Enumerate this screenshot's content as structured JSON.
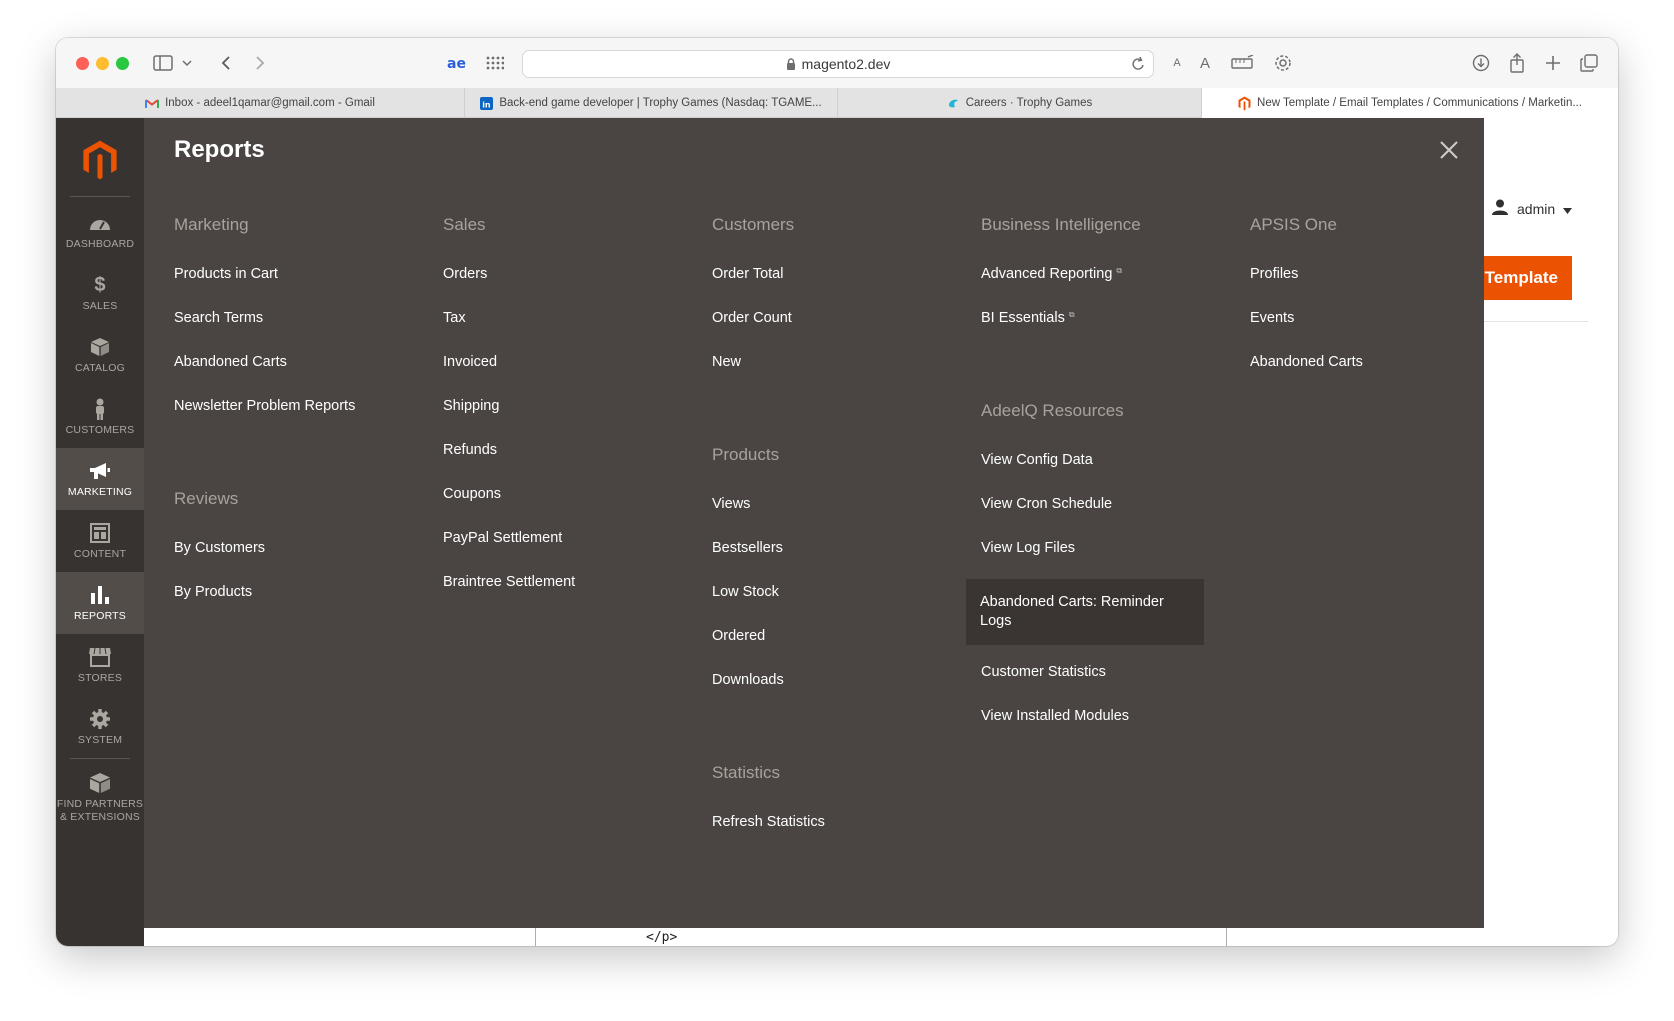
{
  "browser": {
    "address": "magento2.dev",
    "tabs": [
      {
        "label": "Inbox - adeel1qamar@gmail.com - Gmail",
        "icon": "gmail-icon"
      },
      {
        "label": "Back-end game developer | Trophy Games (Nasdaq: TGAME...",
        "icon": "linkedin-icon"
      },
      {
        "label": "Careers · Trophy Games",
        "icon": "trophy-games-icon"
      },
      {
        "label": "New Template / Email Templates / Communications / Marketin...",
        "icon": "magento-icon",
        "active": true
      }
    ]
  },
  "sidebar": {
    "items": [
      {
        "label": "DASHBOARD",
        "icon": "dashboard-icon"
      },
      {
        "label": "SALES",
        "icon": "dollar-icon"
      },
      {
        "label": "CATALOG",
        "icon": "catalog-box-icon"
      },
      {
        "label": "CUSTOMERS",
        "icon": "customers-icon"
      },
      {
        "label": "MARKETING",
        "icon": "megaphone-icon"
      },
      {
        "label": "CONTENT",
        "icon": "content-layout-icon"
      },
      {
        "label": "REPORTS",
        "icon": "bar-chart-icon",
        "active": true
      },
      {
        "label": "STORES",
        "icon": "store-icon"
      },
      {
        "label": "SYSTEM",
        "icon": "gear-icon"
      },
      {
        "label": "FIND PARTNERS",
        "label2": "& EXTENSIONS",
        "icon": "extensions-box-icon"
      }
    ]
  },
  "header": {
    "user": "admin",
    "button_partial": "Template"
  },
  "background": {
    "code_snippet": "</p>"
  },
  "menu": {
    "title": "Reports",
    "columns": [
      {
        "sections": [
          {
            "heading": "Marketing",
            "items": [
              "Products in Cart",
              "Search Terms",
              "Abandoned Carts",
              "Newsletter Problem Reports"
            ]
          },
          {
            "heading": "Reviews",
            "items": [
              "By Customers",
              "By Products"
            ]
          }
        ]
      },
      {
        "sections": [
          {
            "heading": "Sales",
            "items": [
              "Orders",
              "Tax",
              "Invoiced",
              "Shipping",
              "Refunds",
              "Coupons",
              "PayPal Settlement",
              "Braintree Settlement"
            ]
          }
        ]
      },
      {
        "sections": [
          {
            "heading": "Customers",
            "items": [
              "Order Total",
              "Order Count",
              "New"
            ]
          },
          {
            "heading": "Products",
            "items": [
              "Views",
              "Bestsellers",
              "Low Stock",
              "Ordered",
              "Downloads"
            ]
          },
          {
            "heading": "Statistics",
            "items": [
              "Refresh Statistics"
            ]
          }
        ]
      },
      {
        "sections": [
          {
            "heading": "Business Intelligence",
            "items": [
              "Advanced Reporting",
              "BI Essentials"
            ]
          },
          {
            "heading": "AdeelQ Resources",
            "items": [
              "View Config Data",
              "View Cron Schedule",
              "View Log Files",
              "Abandoned Carts: Reminder Logs",
              "Customer Statistics",
              "View Installed Modules"
            ]
          }
        ]
      },
      {
        "sections": [
          {
            "heading": "APSIS One",
            "items": [
              "Profiles",
              "Events",
              "Abandoned Carts"
            ]
          }
        ]
      }
    ]
  }
}
